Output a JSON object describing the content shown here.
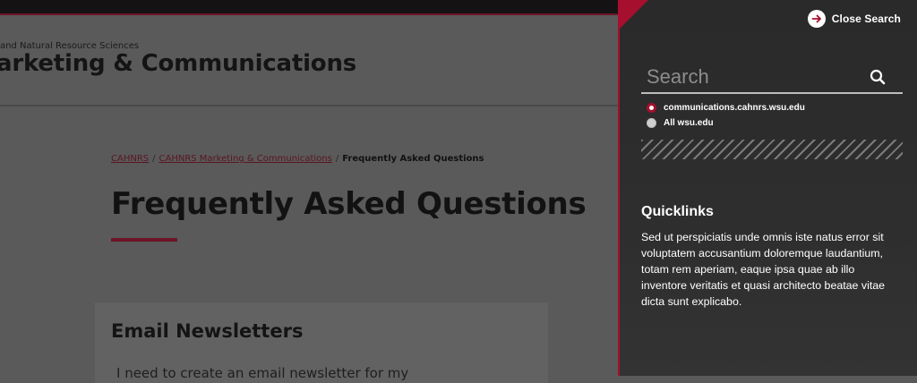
{
  "site": {
    "college": "and Natural Resource Sciences",
    "title": "arketing & Communications"
  },
  "breadcrumb": [
    {
      "label": "CAHNRS",
      "link": true
    },
    {
      "label": "CAHNRS Marketing & Communications",
      "link": true
    },
    {
      "label": "Frequently Asked Questions",
      "link": false
    }
  ],
  "breadcrumb_separator": "/",
  "main": {
    "page_title": "Frequently Asked Questions",
    "card_title": "Email Newsletters",
    "card_text": "I need to create an email newsletter for my"
  },
  "search_panel": {
    "close_label": "Close Search",
    "close_icon": "arrow-right-icon",
    "search_placeholder": "Search",
    "search_value": "",
    "search_icon": "search-icon",
    "scope_options": [
      {
        "label": "communications.cahnrs.wsu.edu",
        "checked": true
      },
      {
        "label": "All wsu.edu",
        "checked": false
      }
    ],
    "quicklinks_title": "Quicklinks",
    "quicklinks_text": "Sed ut perspiciatis unde omnis iste natus error sit voluptatem accusantium doloremque laudantium, totam rem aperiam, eaque ipsa quae ab illo inventore veritatis et quasi architecto beatae vitae dicta sunt explicabo."
  },
  "colors": {
    "accent": "#a60f2d",
    "overlay_panel": "#2c2c2c",
    "dimmed_page": "#5a5a5a"
  }
}
